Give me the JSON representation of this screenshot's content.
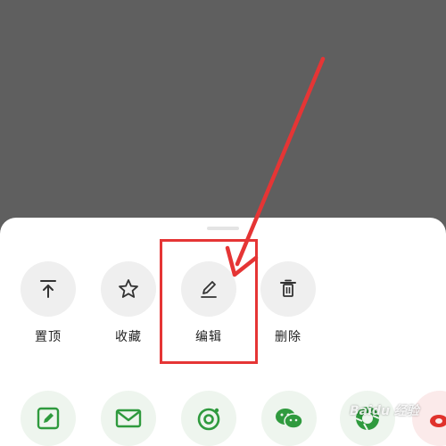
{
  "actions": [
    {
      "label": "置顶",
      "icon": "pin-top-icon"
    },
    {
      "label": "收藏",
      "icon": "star-icon"
    },
    {
      "label": "编辑",
      "icon": "pencil-icon"
    },
    {
      "label": "删除",
      "icon": "trash-icon"
    }
  ],
  "share_targets": [
    {
      "icon": "note-edit-icon"
    },
    {
      "icon": "mail-icon"
    },
    {
      "icon": "moments-icon"
    },
    {
      "icon": "wechat-icon"
    },
    {
      "icon": "camera-shutter-icon"
    },
    {
      "icon": "weibo-icon"
    }
  ],
  "watermark": "Baidu 经验",
  "colors": {
    "accent_green": "#2f9a3e",
    "annotation_red": "#e53535",
    "overlay": "#5f5f5f"
  }
}
